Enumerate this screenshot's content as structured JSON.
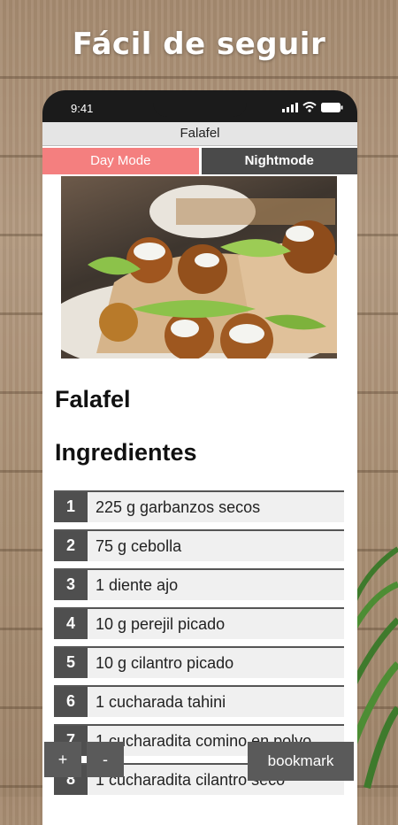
{
  "headline": "Fácil de seguir",
  "status": {
    "time": "9:41"
  },
  "app": {
    "title": "Falafel"
  },
  "modes": {
    "day": "Day Mode",
    "night": "Nightmode"
  },
  "recipe": {
    "title": "Falafel",
    "section": "Ingredientes"
  },
  "ingredients": [
    {
      "num": "1",
      "text": "225 g garbanzos secos"
    },
    {
      "num": "2",
      "text": "75 g cebolla"
    },
    {
      "num": "3",
      "text": "1 diente ajo"
    },
    {
      "num": "4",
      "text": "10 g perejil picado"
    },
    {
      "num": "5",
      "text": "10 g cilantro picado"
    },
    {
      "num": "6",
      "text": "1 cucharada tahini"
    },
    {
      "num": "7",
      "text": "1 cucharadita comino en polvo"
    },
    {
      "num": "8",
      "text": "1 cucharadita cilantro seco"
    }
  ],
  "controls": {
    "plus": "+",
    "minus": "-",
    "bookmark": "bookmark"
  },
  "colors": {
    "day_mode": "#f47f7f",
    "night_mode": "#4a4a4a",
    "phone": "#1b1b1b"
  },
  "icons": {
    "signal": "signal-icon",
    "wifi": "wifi-icon",
    "battery": "battery-icon"
  }
}
